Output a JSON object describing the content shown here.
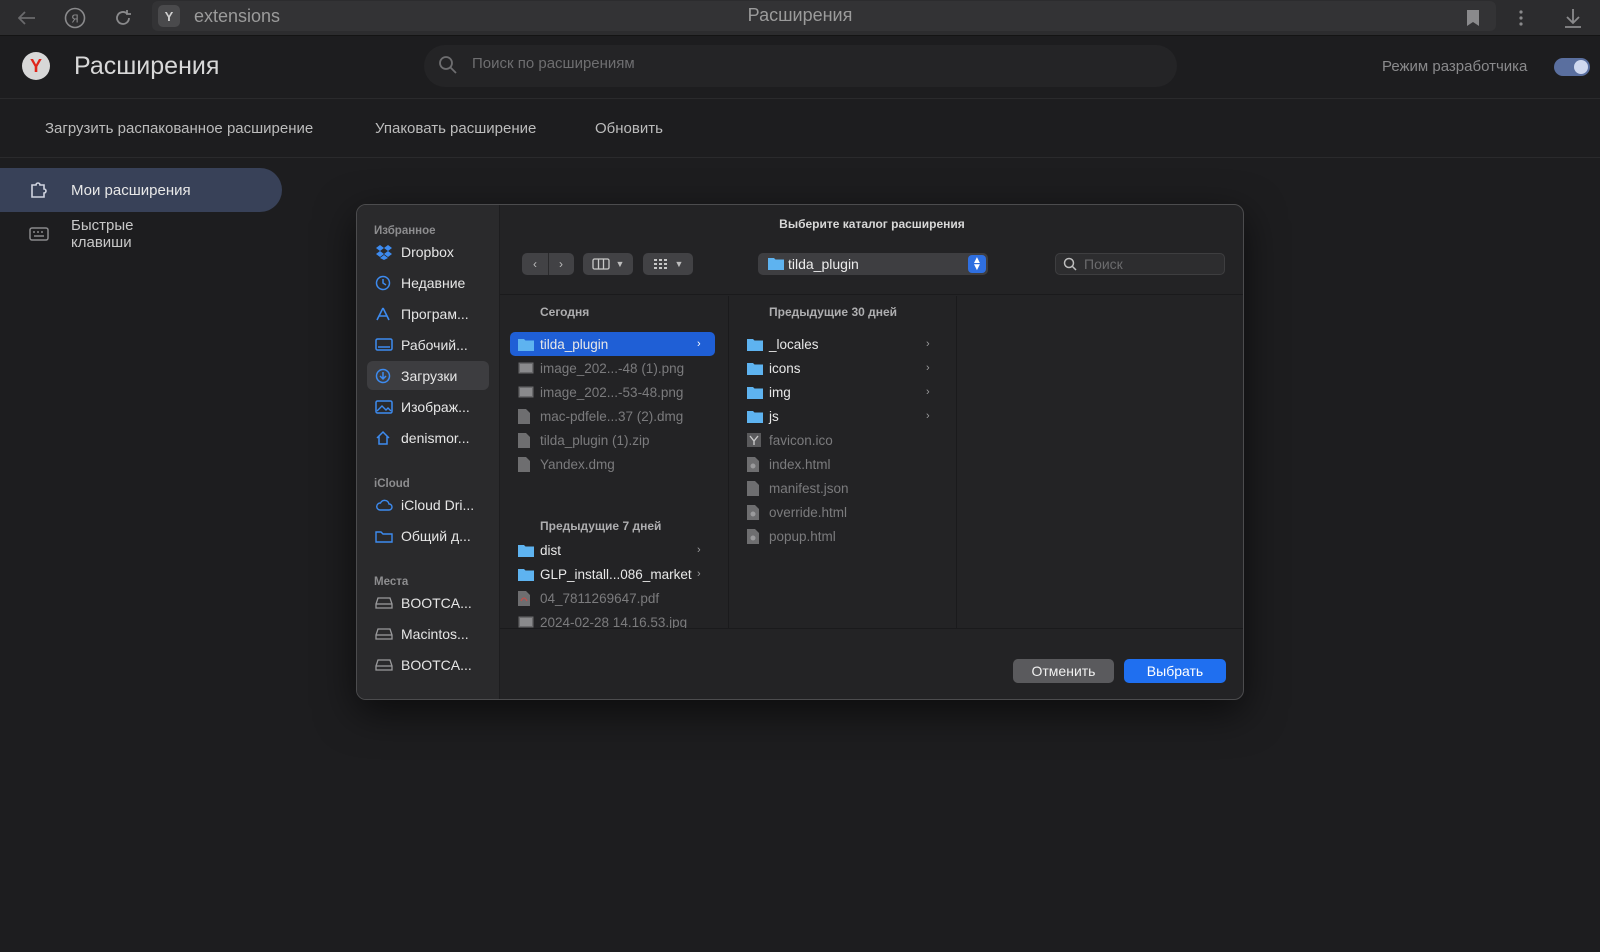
{
  "browser": {
    "address_text": "extensions",
    "tab_title": "Расширения"
  },
  "header": {
    "title": "Расширения",
    "search_placeholder": "Поиск по расширениям",
    "dev_mode_label": "Режим разработчика",
    "dev_mode_on": true
  },
  "toolbar": {
    "load_unpacked": "Загрузить распакованное расширение",
    "pack": "Упаковать расширение",
    "update": "Обновить"
  },
  "nav": {
    "my_extensions": "Мои расширения",
    "shortcuts": "Быстрые клавиши"
  },
  "dialog": {
    "title": "Выберите каталог расширения",
    "path": "tilda_plugin",
    "search_placeholder": "Поиск",
    "cancel": "Отменить",
    "choose": "Выбрать",
    "sidebar": {
      "favorites_title": "Избранное",
      "favorites": [
        "Dropbox",
        "Недавние",
        "Програм...",
        "Рабочий...",
        "Загрузки",
        "Изображ...",
        "denismor..."
      ],
      "icloud_title": "iCloud",
      "icloud": [
        "iCloud Dri...",
        "Общий д..."
      ],
      "places_title": "Места",
      "places": [
        "BOOTCA...",
        "Macintos...",
        "BOOTCA..."
      ]
    },
    "col1": {
      "today_title": "Сегодня",
      "today": [
        {
          "name": "tilda_plugin",
          "kind": "folder"
        },
        {
          "name": "image_202...-48 (1).png",
          "kind": "image"
        },
        {
          "name": "image_202...-53-48.png",
          "kind": "image"
        },
        {
          "name": "mac-pdfele...37 (2).dmg",
          "kind": "file"
        },
        {
          "name": "tilda_plugin (1).zip",
          "kind": "file"
        },
        {
          "name": "Yandex.dmg",
          "kind": "file"
        }
      ],
      "week_title": "Предыдущие 7 дней",
      "week": [
        {
          "name": "dist",
          "kind": "folder"
        },
        {
          "name": "GLP_install...086_market",
          "kind": "folder"
        },
        {
          "name": "04_7811269647.pdf",
          "kind": "pdf"
        },
        {
          "name": "2024-02-28 14.16.53.jpg",
          "kind": "image"
        }
      ]
    },
    "col2": {
      "title": "Предыдущие 30 дней",
      "items": [
        {
          "name": "_locales",
          "kind": "folder"
        },
        {
          "name": "icons",
          "kind": "folder"
        },
        {
          "name": "img",
          "kind": "folder"
        },
        {
          "name": "js",
          "kind": "folder"
        },
        {
          "name": "favicon.ico",
          "kind": "ico"
        },
        {
          "name": "index.html",
          "kind": "html"
        },
        {
          "name": "manifest.json",
          "kind": "file"
        },
        {
          "name": "override.html",
          "kind": "html"
        },
        {
          "name": "popup.html",
          "kind": "html"
        }
      ]
    }
  }
}
